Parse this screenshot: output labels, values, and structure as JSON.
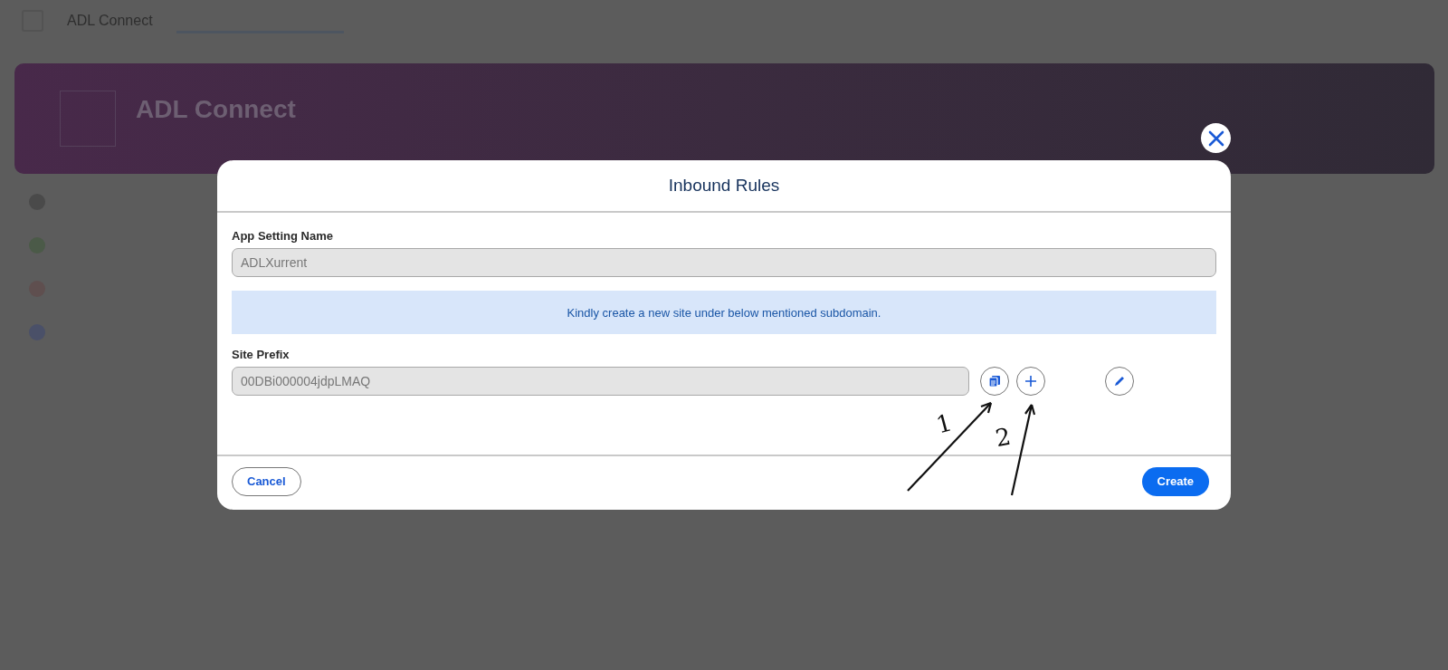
{
  "top_bar": {
    "app_title": "ADL Connect"
  },
  "banner": {
    "title": "ADL Connect"
  },
  "modal": {
    "title": "Inbound Rules",
    "fields": [
      {
        "label": "App Setting Name",
        "value": "ADLXurrent",
        "disabled": true
      }
    ],
    "info": "Kindly create a new site under below mentioned subdomain.",
    "site_prefix": {
      "label": "Site Prefix",
      "value": "00DBi000004jdpLMAQ",
      "disabled": true
    },
    "buttons": {
      "cancel": "Cancel",
      "create": "Create"
    }
  },
  "annotations": [
    {
      "label": "1"
    },
    {
      "label": "2"
    }
  ]
}
